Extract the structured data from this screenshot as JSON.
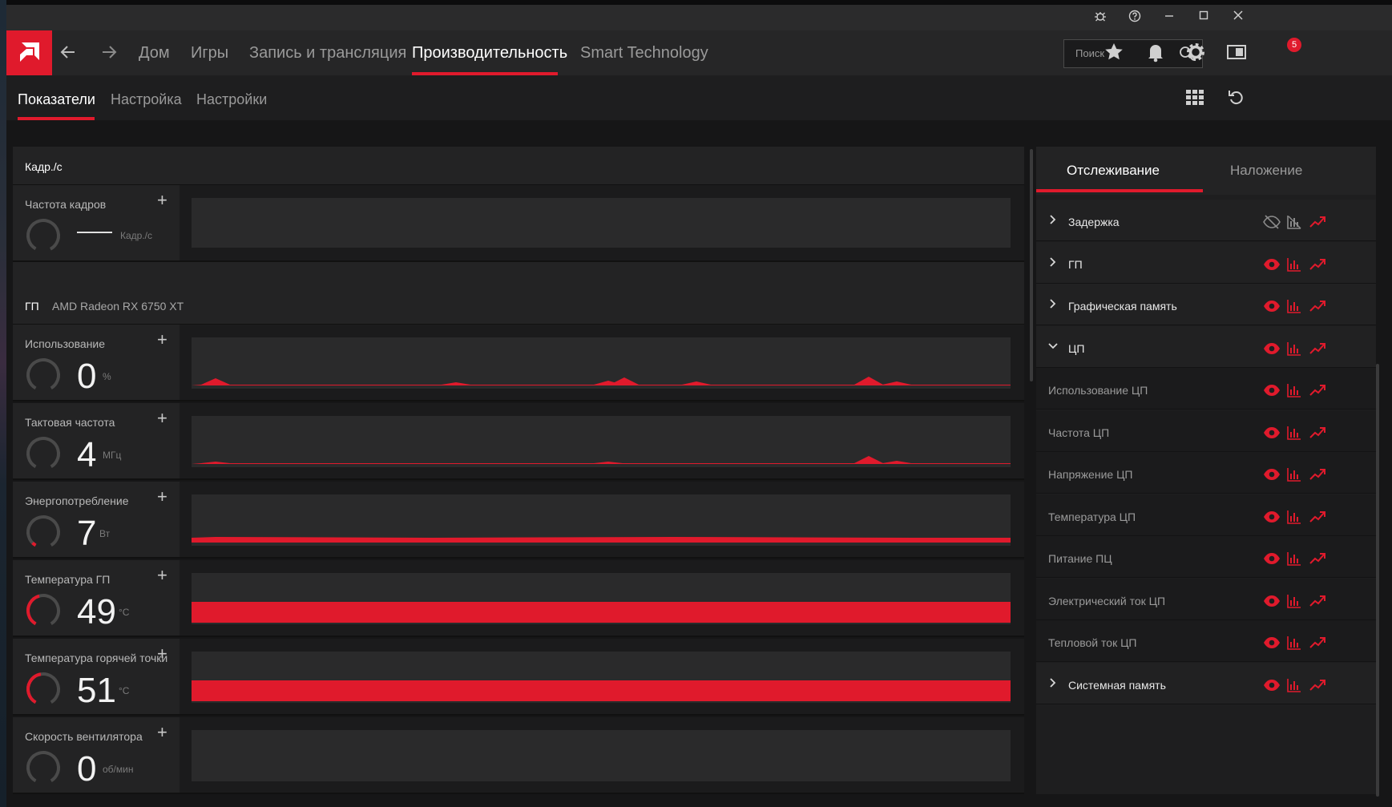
{
  "titlebar": {
    "icons": [
      "bug-icon",
      "help-icon",
      "minimize-icon",
      "maximize-icon",
      "close-icon"
    ]
  },
  "nav": {
    "items": [
      {
        "label": "Дом",
        "active": false
      },
      {
        "label": "Игры",
        "active": false
      },
      {
        "label": "Запись и трансляция",
        "active": false
      },
      {
        "label": "Производительность",
        "active": true
      },
      {
        "label": "Smart Technology",
        "active": false
      }
    ],
    "search_placeholder": "Поиск",
    "notification_count": "5"
  },
  "subnav": {
    "items": [
      {
        "label": "Показатели",
        "active": true
      },
      {
        "label": "Настройка",
        "active": false
      },
      {
        "label": "Настройки",
        "active": false
      }
    ]
  },
  "fps_section": {
    "title": "Кадр./с",
    "metric": {
      "name": "Частота кадров",
      "value": "—",
      "unit": "Кадр./с"
    }
  },
  "gpu_section": {
    "title": "ГП",
    "subtitle": "AMD Radeon RX 6750 XT",
    "metrics": [
      {
        "name": "Использование",
        "value": "0",
        "unit": "%",
        "gauge_level": 0.0
      },
      {
        "name": "Тактовая частота",
        "value": "4",
        "unit": "МГц",
        "gauge_level": 0.0
      },
      {
        "name": "Энергопотребление",
        "value": "7",
        "unit": "Вт",
        "gauge_level": 0.05
      },
      {
        "name": "Температура ГП",
        "value": "49",
        "unit": "°C",
        "gauge_level": 0.45
      },
      {
        "name": "Температура горячей точки",
        "value": "51",
        "unit": "°C",
        "gauge_level": 0.47
      },
      {
        "name": "Скорость вентилятора",
        "value": "0",
        "unit": "об/мин",
        "gauge_level": 0.0
      }
    ]
  },
  "right_panel": {
    "tabs": [
      {
        "label": "Отслеживание",
        "active": true
      },
      {
        "label": "Наложение",
        "active": false
      }
    ],
    "rows": [
      {
        "label": "Задержка",
        "type": "group",
        "expanded": false,
        "enabled": false
      },
      {
        "label": "ГП",
        "type": "group",
        "expanded": false,
        "enabled": true
      },
      {
        "label": "Графическая память",
        "type": "group",
        "expanded": false,
        "enabled": true
      },
      {
        "label": "ЦП",
        "type": "group",
        "expanded": true,
        "enabled": true
      },
      {
        "label": "Использование ЦП",
        "type": "item",
        "enabled": true
      },
      {
        "label": "Частота ЦП",
        "type": "item",
        "enabled": true
      },
      {
        "label": "Напряжение ЦП",
        "type": "item",
        "enabled": true
      },
      {
        "label": "Температура ЦП",
        "type": "item",
        "enabled": true
      },
      {
        "label": "Питание ПЦ",
        "type": "item",
        "enabled": true
      },
      {
        "label": "Электрический ток ЦП",
        "type": "item",
        "enabled": true
      },
      {
        "label": "Тепловой ток ЦП",
        "type": "item",
        "enabled": true
      },
      {
        "label": "Системная память",
        "type": "group",
        "expanded": false,
        "enabled": true
      }
    ]
  },
  "colors": {
    "accent": "#e01a2c",
    "disabled_icon": "#8a8a8a"
  }
}
